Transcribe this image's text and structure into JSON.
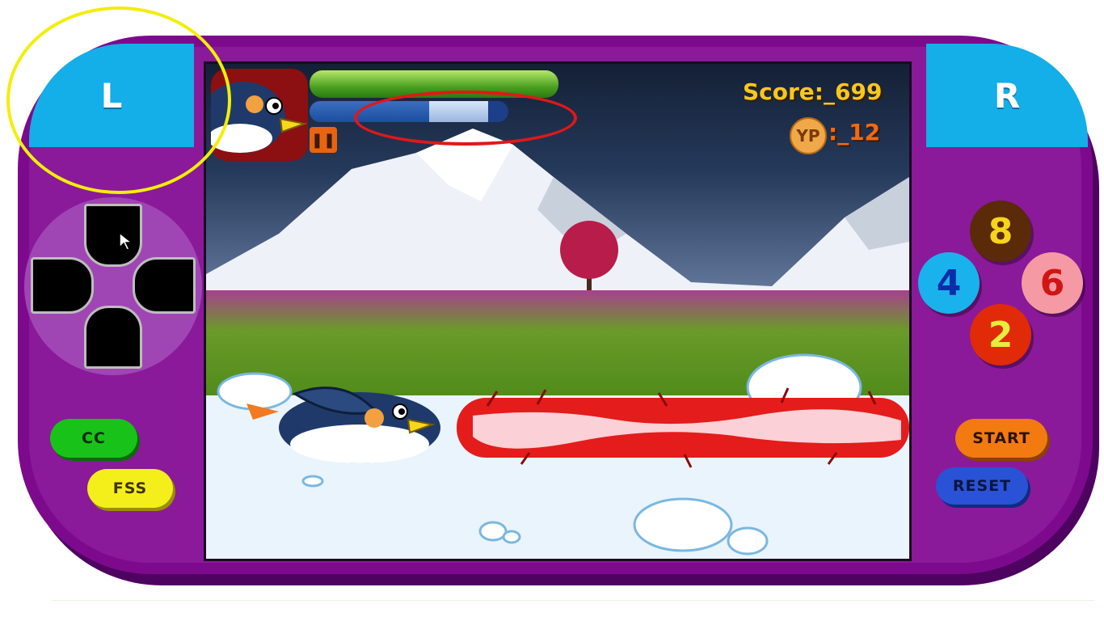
{
  "console": {
    "left_shoulder": "L",
    "right_shoulder": "R",
    "cc_label": "CC",
    "fss_label": "FSS",
    "start_label": "START",
    "reset_label": "RESET",
    "number_buttons": {
      "up": "8",
      "left": "4",
      "right": "6",
      "down": "2"
    },
    "colors": {
      "body": "#7d0a8c",
      "shoulder": "#14aee8"
    }
  },
  "hud": {
    "score_text": "Score:_699",
    "yp_icon": "YP",
    "yp_text": ":_12",
    "pause_icon": "pause-icon",
    "health_level": 1.0,
    "energy_level": 0.6,
    "energy_highlight_level": 0.3
  },
  "annotations": {
    "yellow_circle_color": "#f2ee0a",
    "red_ellipse_color": "#e01818"
  }
}
